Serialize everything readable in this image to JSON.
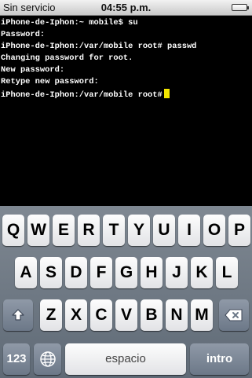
{
  "status_bar": {
    "carrier": "Sin servicio",
    "time": "04:55 p.m.",
    "battery_icon": "battery-icon"
  },
  "terminal": {
    "lines": [
      "iPhone-de-Iphon:~ mobile$ su",
      "Password:",
      "iPhone-de-Iphon:/var/mobile root# passwd",
      "Changing password for root.",
      "New password:",
      "Retype new password:",
      "iPhone-de-Iphon:/var/mobile root#"
    ],
    "cursor_color": "#f3e600"
  },
  "keyboard": {
    "row1": [
      "Q",
      "W",
      "E",
      "R",
      "T",
      "Y",
      "U",
      "I",
      "O",
      "P"
    ],
    "row2": [
      "A",
      "S",
      "D",
      "F",
      "G",
      "H",
      "J",
      "K",
      "L"
    ],
    "row3": [
      "Z",
      "X",
      "C",
      "V",
      "B",
      "N",
      "M"
    ],
    "shift_icon": "shift-arrow-icon",
    "delete_icon": "backspace-icon",
    "numbers_label": "123",
    "globe_icon": "globe-icon",
    "space_label": "espacio",
    "return_label": "intro"
  }
}
